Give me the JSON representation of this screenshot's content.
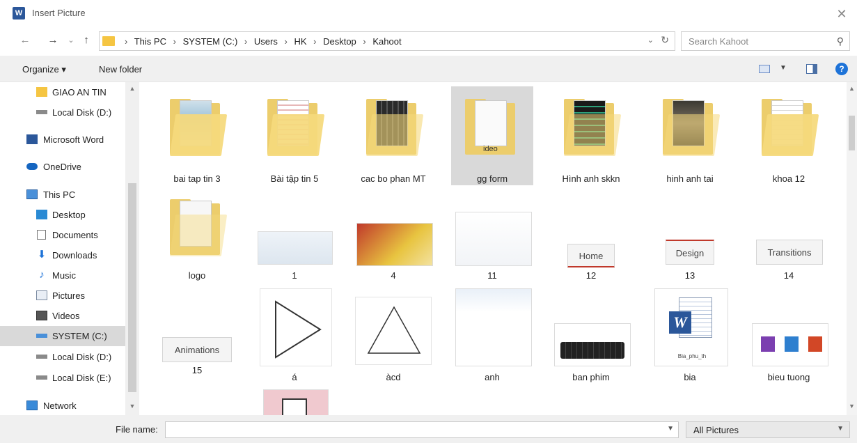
{
  "window": {
    "title": "Insert Picture",
    "app_icon_letter": "W",
    "close_glyph": "✕"
  },
  "nav": {
    "back": "←",
    "forward": "→",
    "recent": "⌄",
    "up": "↑"
  },
  "breadcrumbs": [
    "This PC",
    "SYSTEM (C:)",
    "Users",
    "HK",
    "Desktop",
    "Kahoot"
  ],
  "breadcrumb_separator": "›",
  "search": {
    "placeholder": "Search Kahoot"
  },
  "toolbar": {
    "organize_label": "Organize ▾",
    "new_folder_label": "New folder",
    "help_glyph": "?"
  },
  "sidebar": {
    "items": [
      {
        "label": "GIAO AN TIN",
        "icon": "folder-icon"
      },
      {
        "label": "Local Disk (D:)",
        "icon": "drive-icon"
      },
      {
        "label": "Microsoft Word",
        "icon": "word-icon"
      },
      {
        "label": "OneDrive",
        "icon": "cloud-icon"
      },
      {
        "label": "This PC",
        "icon": "pc-icon"
      },
      {
        "label": "Desktop",
        "icon": "desktop-icon"
      },
      {
        "label": "Documents",
        "icon": "documents-icon"
      },
      {
        "label": "Downloads",
        "icon": "download-icon"
      },
      {
        "label": "Music",
        "icon": "music-icon"
      },
      {
        "label": "Pictures",
        "icon": "pictures-icon"
      },
      {
        "label": "Videos",
        "icon": "videos-icon"
      },
      {
        "label": "SYSTEM (C:)",
        "icon": "system-drive-icon",
        "selected": true
      },
      {
        "label": "Local Disk (D:)",
        "icon": "drive-icon"
      },
      {
        "label": "Local Disk (E:)",
        "icon": "drive-icon"
      },
      {
        "label": "Network",
        "icon": "network-icon"
      }
    ]
  },
  "files": {
    "folders": [
      {
        "label": "bai tap tin 3"
      },
      {
        "label": "Bài tập tin 5"
      },
      {
        "label": "cac bo phan MT"
      },
      {
        "label": "gg form",
        "selected": true,
        "inner_text": "ideo"
      },
      {
        "label": "Hình anh skkn"
      },
      {
        "label": "hinh anh tai"
      },
      {
        "label": "khoa 12"
      },
      {
        "label": "logo"
      }
    ],
    "images": [
      {
        "label": "1"
      },
      {
        "label": "4"
      },
      {
        "label": "11"
      },
      {
        "label": "12",
        "button_text": "Home"
      },
      {
        "label": "13",
        "button_text": "Design"
      },
      {
        "label": "14",
        "button_text": "Transitions"
      },
      {
        "label": "15",
        "button_text": "Animations"
      },
      {
        "label": "á"
      },
      {
        "label": "àcd"
      },
      {
        "label": "anh"
      },
      {
        "label": "ban phim"
      },
      {
        "label": "bia",
        "caption": "Bia_phu_th"
      },
      {
        "label": "bieu tuong"
      }
    ]
  },
  "bottom": {
    "file_name_label": "File name:",
    "file_name_value": "",
    "filter_value": "All Pictures"
  },
  "colors": {
    "accent": "#1e73d8",
    "folder": "#eccd6c",
    "selected_bg": "#d9d9d9",
    "word_blue": "#2b579a"
  }
}
